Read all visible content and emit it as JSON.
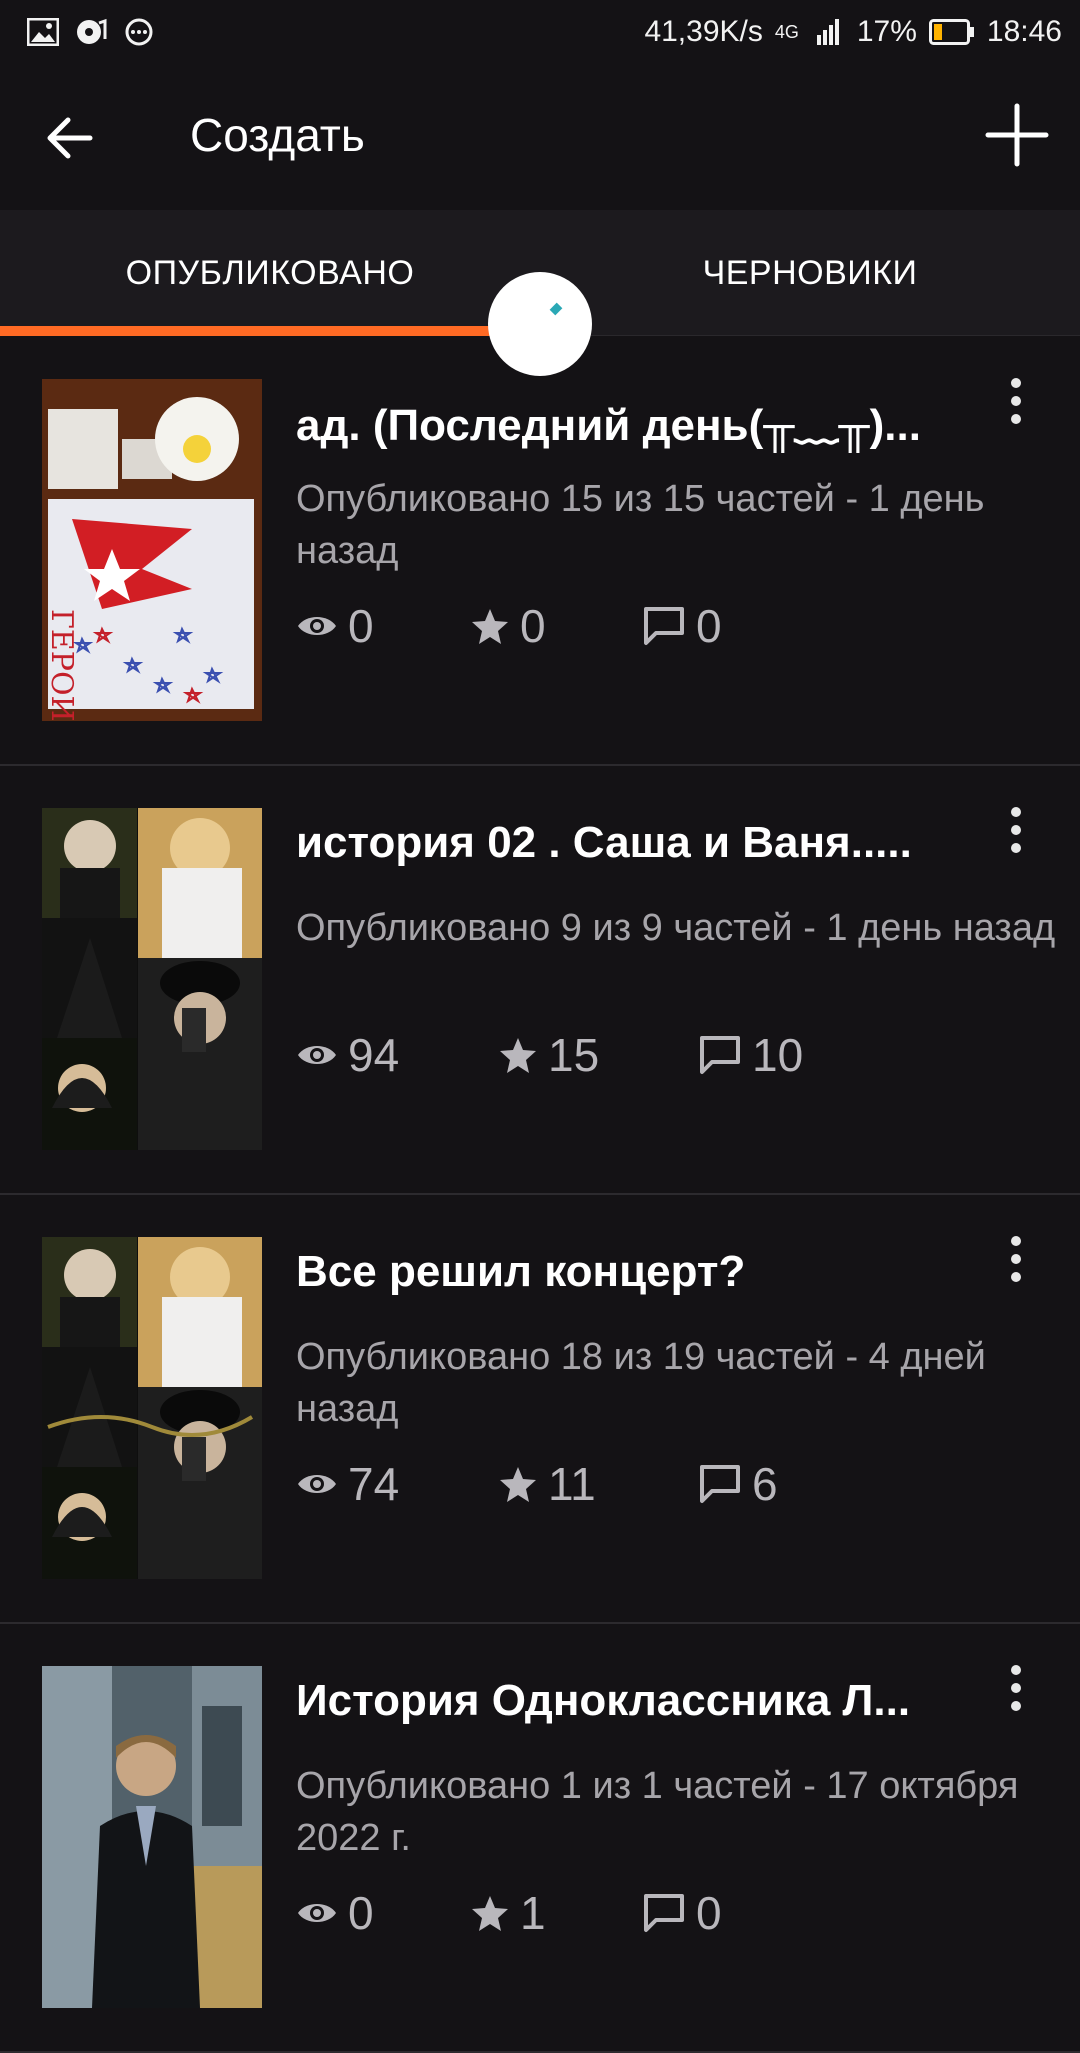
{
  "status_bar": {
    "speed": "41,39K/s",
    "network": "4G",
    "battery": "17%",
    "time": "18:46"
  },
  "app_bar": {
    "title": "Создать"
  },
  "tabs": [
    {
      "label": "ОПУБЛИКОВАНО",
      "selected": true
    },
    {
      "label": "ЧЕРНОВИКИ",
      "selected": false
    }
  ],
  "colors": {
    "accent": "#ff6a24",
    "background": "#141215",
    "meta_text": "#a7a5aa"
  },
  "stories": [
    {
      "title": "ад. (Последний день(╥﹏╥)...",
      "meta": "Опубликовано 15 из 15 частей - 1 день назад",
      "views": "0",
      "votes": "0",
      "comments": "0"
    },
    {
      "title": "история 02 . Саша и Ваня.....",
      "meta": "Опубликовано 9 из 9 частей - 1 день назад",
      "views": "94",
      "votes": "15",
      "comments": "10"
    },
    {
      "title": "Все решил концерт?",
      "meta": "Опубликовано 18 из 19 частей - 4 дней назад",
      "views": "74",
      "votes": "11",
      "comments": "6"
    },
    {
      "title": "История Одноклассника Л...",
      "meta": "Опубликовано 1 из 1 частей - 17 октября 2022 г.",
      "views": "0",
      "votes": "1",
      "comments": "0"
    }
  ]
}
